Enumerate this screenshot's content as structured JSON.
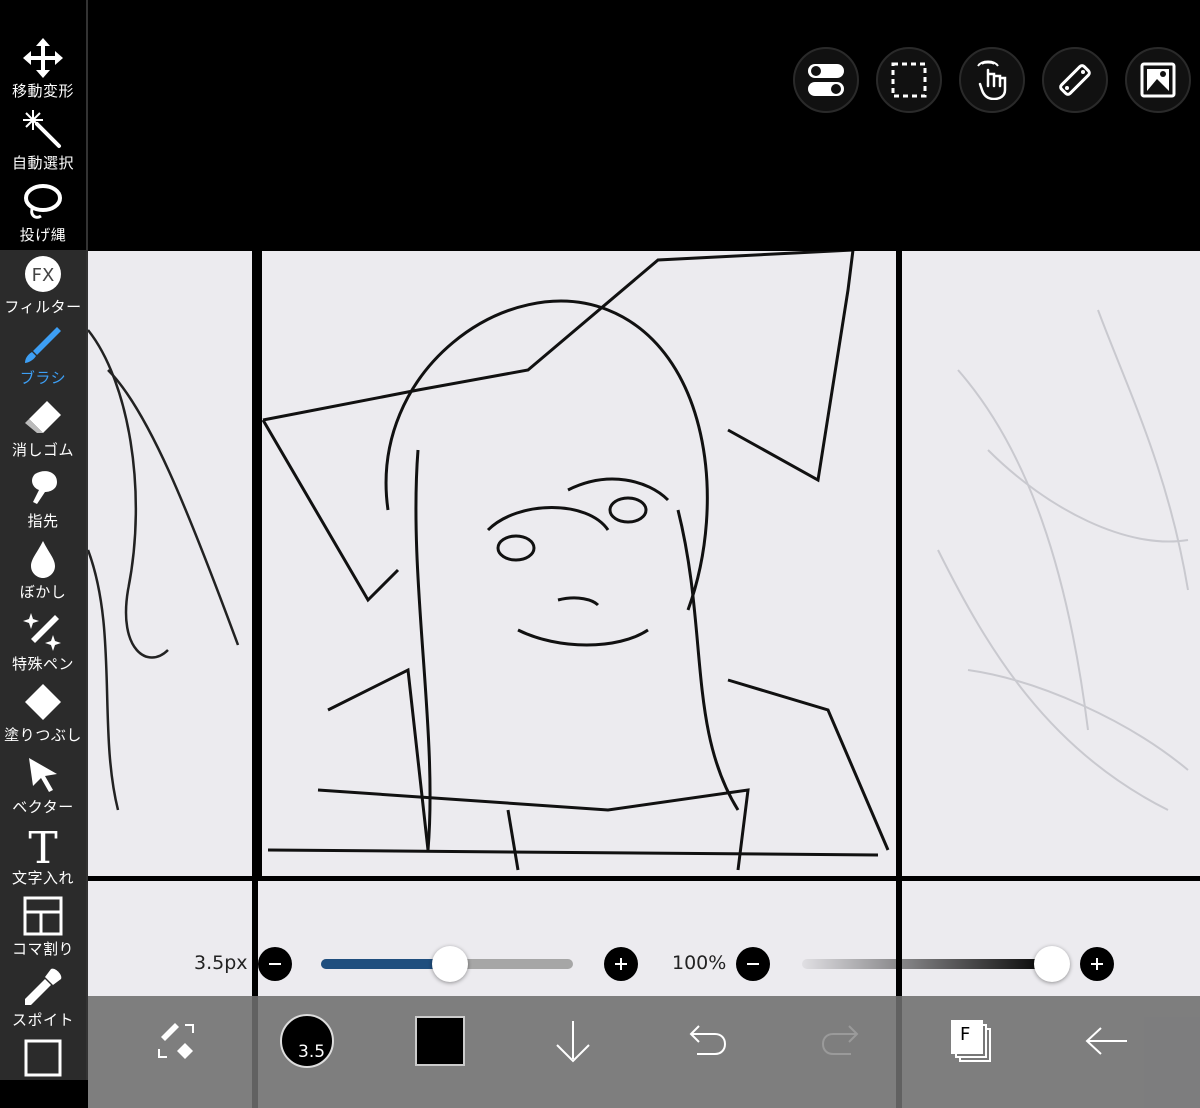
{
  "sidebar": {
    "tools": [
      {
        "label": "移動変形",
        "icon": "move-icon"
      },
      {
        "label": "自動選択",
        "icon": "magic-wand-icon"
      },
      {
        "label": "投げ縄",
        "icon": "lasso-icon"
      },
      {
        "label": "フィルター",
        "icon": "fx-icon"
      },
      {
        "label": "ブラシ",
        "icon": "brush-icon",
        "active": true
      },
      {
        "label": "消しゴム",
        "icon": "eraser-icon"
      },
      {
        "label": "指先",
        "icon": "finger-icon"
      },
      {
        "label": "ぼかし",
        "icon": "blur-drop-icon"
      },
      {
        "label": "特殊ペン",
        "icon": "sparkle-pen-icon"
      },
      {
        "label": "塗りつぶし",
        "icon": "fill-bucket-icon"
      },
      {
        "label": "ベクター",
        "icon": "vector-arrow-icon"
      },
      {
        "label": "文字入れ",
        "icon": "text-t-icon"
      },
      {
        "label": "コマ割り",
        "icon": "frame-divider-icon"
      },
      {
        "label": "スポイト",
        "icon": "eyedropper-icon"
      }
    ]
  },
  "top_buttons": [
    "toggle-icon",
    "selection-rect-icon",
    "gesture-hand-icon",
    "ruler-icon",
    "image-icon"
  ],
  "brush_size": {
    "label": "3.5px",
    "value_fraction": 0.51
  },
  "opacity": {
    "label": "100%",
    "value_fraction": 1.0
  },
  "bottom_bar": {
    "brush_size_badge": "3.5",
    "color": "#000000",
    "layers_badge": "F"
  },
  "colors": {
    "accent": "#3d9ff5",
    "slider_fill": "#1f4e7e"
  }
}
